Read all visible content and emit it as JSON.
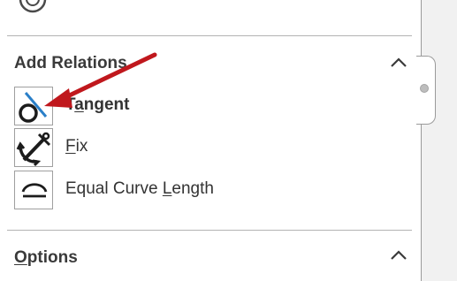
{
  "add_relations": {
    "title": "Add Relations",
    "items": [
      {
        "name": "tangent",
        "label_pre": "T",
        "label_accel": "a",
        "label_post": "ngent",
        "icon": "tangent-icon",
        "bold": true
      },
      {
        "name": "fix",
        "label_pre": "",
        "label_accel": "F",
        "label_post": "ix",
        "icon": "fix-anchor-icon",
        "bold": false
      },
      {
        "name": "equal-curve-length",
        "label_pre": "Equal Curve ",
        "label_accel": "L",
        "label_post": "ength",
        "icon": "equal-curve-length-icon",
        "bold": false
      }
    ]
  },
  "options": {
    "title_accel": "O",
    "title_rest": "ptions"
  },
  "colors": {
    "arrow": "#c0181d",
    "icon_accent": "#2a7fc8",
    "icon_dark": "#1c1c1c"
  },
  "icons": {
    "top_partial": "circle-icon",
    "collapse": "chevron-up-icon",
    "splitter": "splitter-handle-icon",
    "annotation": "red-arrow-annotation"
  }
}
